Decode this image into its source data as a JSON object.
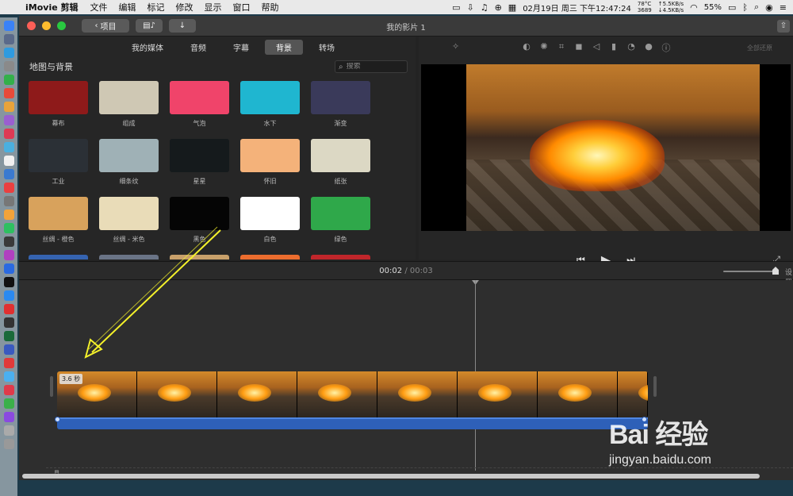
{
  "menubar": {
    "app_name": "iMovie 剪辑",
    "items": [
      "文件",
      "编辑",
      "标记",
      "修改",
      "显示",
      "窗口",
      "帮助"
    ],
    "datetime": "02月19日 周三 下午12:47:24",
    "cpu_temp": "78°C",
    "fan_rpm": "3689",
    "net_up": "↑5.5KB/s",
    "net_down": "↓4.5KB/s",
    "battery": "55%"
  },
  "window": {
    "title": "我的影片 1",
    "back_button": "项目"
  },
  "browser": {
    "tabs": [
      {
        "label": "我的媒体",
        "active": false
      },
      {
        "label": "音频",
        "active": false
      },
      {
        "label": "字幕",
        "active": false
      },
      {
        "label": "背景",
        "active": true
      },
      {
        "label": "转场",
        "active": false
      }
    ],
    "section_title": "地图与背景",
    "search_placeholder": "搜索",
    "backgrounds": [
      {
        "label": "幕布",
        "color": "#8e1a1a"
      },
      {
        "label": "组成",
        "color": "#cfc8b4"
      },
      {
        "label": "气泡",
        "color": "#f0446a"
      },
      {
        "label": "水下",
        "color": "#1fb6d0"
      },
      {
        "label": "渐变",
        "color": "#3a3a5a"
      },
      {
        "label": "工业",
        "color": "#2b3036"
      },
      {
        "label": "细条纹",
        "color": "#9fb1b6"
      },
      {
        "label": "星星",
        "color": "#151a1c"
      },
      {
        "label": "怀旧",
        "color": "#f4b27a"
      },
      {
        "label": "纸张",
        "color": "#dcd8c4"
      },
      {
        "label": "丝绸 - 橙色",
        "color": "#d8a25c"
      },
      {
        "label": "丝绸 - 米色",
        "color": "#e9dcb8"
      },
      {
        "label": "黑色",
        "color": "#050505"
      },
      {
        "label": "白色",
        "color": "#ffffff"
      },
      {
        "label": "绿色",
        "color": "#2fa84a"
      }
    ],
    "partial_row_colors": [
      "#3563b0",
      "#6a7486",
      "#c8a06a",
      "#ec6d2e",
      "#c0262b"
    ]
  },
  "viewer": {
    "reset_label": "全部还原"
  },
  "timeline": {
    "current_time": "00:02",
    "separator": "/",
    "total_time": "00:03",
    "clip_duration": "3.6 秒",
    "settings_label": "设置"
  },
  "watermark": {
    "logo": "Bai 经验",
    "url": "jingyan.baidu.com"
  }
}
